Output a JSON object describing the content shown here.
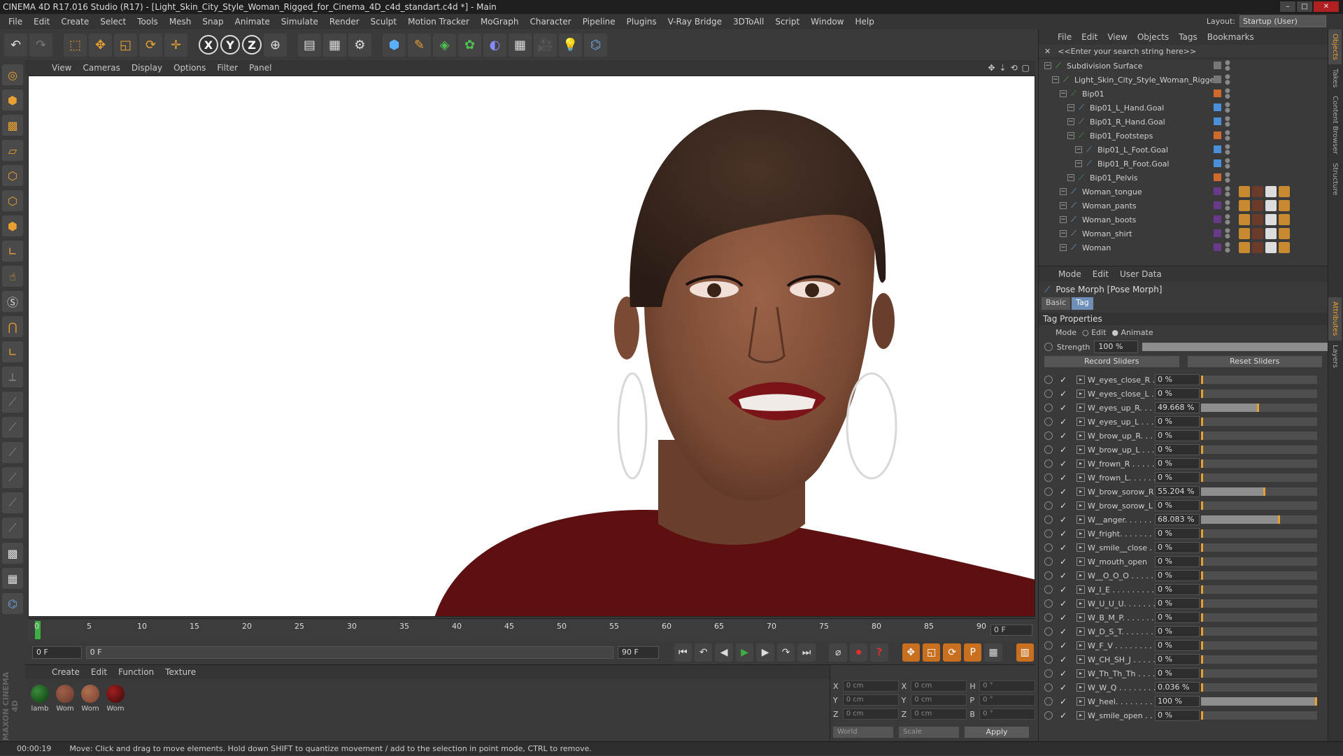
{
  "window": {
    "title": "CINEMA 4D R17.016 Studio (R17) - [Light_Skin_City_Style_Woman_Rigged_for_Cinema_4D_c4d_standart.c4d *] - Main"
  },
  "menubar": {
    "items": [
      "File",
      "Edit",
      "Create",
      "Select",
      "Tools",
      "Mesh",
      "Snap",
      "Animate",
      "Simulate",
      "Render",
      "Sculpt",
      "Motion Tracker",
      "MoGraph",
      "Character",
      "Pipeline",
      "Plugins",
      "V-Ray Bridge",
      "3DToAll",
      "Script",
      "Window",
      "Help"
    ],
    "layout_label": "Layout:",
    "layout_value": "Startup (User)"
  },
  "toolbar": {
    "axis_x": "X",
    "axis_y": "Y",
    "axis_z": "Z"
  },
  "viewport": {
    "menu": [
      "View",
      "Cameras",
      "Display",
      "Options",
      "Filter",
      "Panel"
    ]
  },
  "timeline": {
    "ticks": [
      "0",
      "5",
      "10",
      "15",
      "20",
      "25",
      "30",
      "35",
      "40",
      "45",
      "50",
      "55",
      "60",
      "65",
      "70",
      "75",
      "80",
      "85",
      "90"
    ],
    "frame_box": "0 F"
  },
  "transport": {
    "start_frame": "0 F",
    "range_start": "0 F",
    "range_end": "90 F",
    "end_frame": "90 F"
  },
  "materials": {
    "menu": [
      "Create",
      "Edit",
      "Function",
      "Texture"
    ],
    "items": [
      {
        "label": "lamb",
        "color": "#0d3a10"
      },
      {
        "label": "Wom",
        "color": "#6a3a2a"
      },
      {
        "label": "Wom",
        "color": "#7a4030"
      },
      {
        "label": "Wom",
        "color": "#5a1010"
      }
    ]
  },
  "coords": {
    "rows": [
      {
        "a": "X",
        "av": "0 cm",
        "b": "X",
        "bv": "0 cm",
        "c": "H",
        "cv": "0 °"
      },
      {
        "a": "Y",
        "av": "0 cm",
        "b": "Y",
        "bv": "0 cm",
        "c": "P",
        "cv": "0 °"
      },
      {
        "a": "Z",
        "av": "0 cm",
        "b": "Z",
        "bv": "0 cm",
        "c": "B",
        "cv": "0 °"
      }
    ],
    "world": "World",
    "scale": "Scale",
    "apply": "Apply"
  },
  "status": {
    "time": "00:00:19",
    "message": "Move: Click and drag to move elements. Hold down SHIFT to quantize movement / add to the selection in point mode, CTRL to remove."
  },
  "objects": {
    "menu": [
      "File",
      "Edit",
      "View",
      "Objects",
      "Tags",
      "Bookmarks"
    ],
    "search_placeholder": "<<Enter your search string here>>",
    "rows": [
      {
        "name": "Subdivision Surface",
        "depth": 0,
        "icon_color": "#4fc34f",
        "swatch": "#777"
      },
      {
        "name": "Light_Skin_City_Style_Woman_Rigged",
        "depth": 1,
        "icon_color": "#4fc34f",
        "swatch": "#777"
      },
      {
        "name": "Bip01",
        "depth": 2,
        "icon_color": "#3cb043",
        "swatch": "#d06a2a"
      },
      {
        "name": "Bip01_L_Hand.Goal",
        "depth": 3,
        "icon_color": "#6aa0d8",
        "swatch": "#4a90d8"
      },
      {
        "name": "Bip01_R_Hand.Goal",
        "depth": 3,
        "icon_color": "#6aa0d8",
        "swatch": "#4a90d8"
      },
      {
        "name": "Bip01_Footsteps",
        "depth": 3,
        "icon_color": "#3cb043",
        "swatch": "#d06a2a"
      },
      {
        "name": "Bip01_L_Foot.Goal",
        "depth": 4,
        "icon_color": "#6aa0d8",
        "swatch": "#4a90d8"
      },
      {
        "name": "Bip01_R_Foot.Goal",
        "depth": 4,
        "icon_color": "#6aa0d8",
        "swatch": "#4a90d8"
      },
      {
        "name": "Bip01_Pelvis",
        "depth": 3,
        "icon_color": "#3cb043",
        "swatch": "#d06a2a"
      },
      {
        "name": "Woman_tongue",
        "depth": 2,
        "icon_color": "#7ab0e8",
        "swatch": "#6a3a8a"
      },
      {
        "name": "Woman_pants",
        "depth": 2,
        "icon_color": "#7ab0e8",
        "swatch": "#6a3a8a"
      },
      {
        "name": "Woman_boots",
        "depth": 2,
        "icon_color": "#7ab0e8",
        "swatch": "#6a3a8a"
      },
      {
        "name": "Woman_shirt",
        "depth": 2,
        "icon_color": "#7ab0e8",
        "swatch": "#6a3a8a"
      },
      {
        "name": "Woman",
        "depth": 2,
        "icon_color": "#7ab0e8",
        "swatch": "#6a3a8a"
      }
    ]
  },
  "attributes": {
    "menu": [
      "Mode",
      "Edit",
      "User Data"
    ],
    "title": "Pose Morph [Pose Morph]",
    "tabs": [
      "Basic",
      "Tag"
    ],
    "section": "Tag Properties",
    "mode_label": "Mode",
    "mode_edit": "Edit",
    "mode_animate": "Animate",
    "strength_label": "Strength",
    "strength_value": "100 %",
    "strength_fraction": 1.0,
    "record_btn": "Record Sliders",
    "reset_btn": "Reset Sliders",
    "sliders": [
      {
        "name": "W_eyes_close_R . .",
        "value": "0 %",
        "frac": 0
      },
      {
        "name": "W_eyes_close_L . .",
        "value": "0 %",
        "frac": 0
      },
      {
        "name": "W_eyes_up_R. . . .",
        "value": "49.668 %",
        "frac": 0.497
      },
      {
        "name": "W_eyes_up_L . . . .",
        "value": "0 %",
        "frac": 0
      },
      {
        "name": "W_brow_up_R. . . .",
        "value": "0 %",
        "frac": 0
      },
      {
        "name": "W_brow_up_L . . .",
        "value": "0 %",
        "frac": 0
      },
      {
        "name": "W_frown_R . . . . .",
        "value": "0 %",
        "frac": 0
      },
      {
        "name": "W_frown_L. . . . . .",
        "value": "0 %",
        "frac": 0
      },
      {
        "name": "W_brow_sorow_R",
        "value": "55.204 %",
        "frac": 0.552
      },
      {
        "name": "W_brow_sorow_L",
        "value": "0 %",
        "frac": 0
      },
      {
        "name": "W__anger. . . . . . .",
        "value": "68.083 %",
        "frac": 0.681
      },
      {
        "name": "W_fright. . . . . . . .",
        "value": "0 %",
        "frac": 0
      },
      {
        "name": "W_smile__close . . .",
        "value": "0 %",
        "frac": 0
      },
      {
        "name": "W_mouth_open",
        "value": "0 %",
        "frac": 0
      },
      {
        "name": "W__O_O_O . . . . .",
        "value": "0 %",
        "frac": 0
      },
      {
        "name": "W_I_E . . . . . . . . .",
        "value": "0 %",
        "frac": 0
      },
      {
        "name": "W_U_U_U. . . . . . .",
        "value": "0 %",
        "frac": 0
      },
      {
        "name": "W_B_M_P. . . . . . .",
        "value": "0 %",
        "frac": 0
      },
      {
        "name": "W_D_S_T. . . . . . .",
        "value": "0 %",
        "frac": 0
      },
      {
        "name": "W_F_V . . . . . . . .",
        "value": "0 %",
        "frac": 0
      },
      {
        "name": "W_CH_SH_J . . . . .",
        "value": "0 %",
        "frac": 0
      },
      {
        "name": "W_Th_Th_Th . . . . .",
        "value": "0 %",
        "frac": 0
      },
      {
        "name": "W_W_Q . . . . . . . .",
        "value": "0.036 %",
        "frac": 0.0004
      },
      {
        "name": "W_heel. . . . . . . . .",
        "value": "100 %",
        "frac": 1.0
      },
      {
        "name": "W_smile_open . . . .",
        "value": "0 %",
        "frac": 0
      }
    ]
  },
  "sidetabs": [
    "Objects",
    "Takes",
    "Content Browser",
    "Structure",
    "Attributes",
    "Layers"
  ]
}
